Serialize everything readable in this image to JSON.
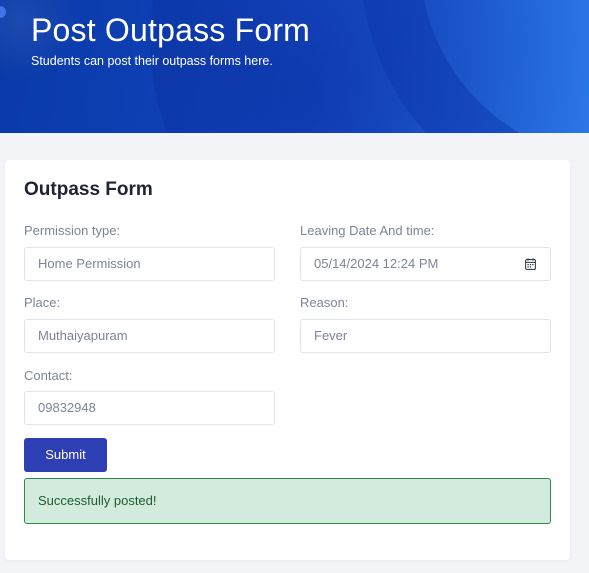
{
  "header": {
    "title": "Post Outpass Form",
    "subtitle": "Students can post their outpass forms here."
  },
  "form": {
    "title": "Outpass Form",
    "permission_type": {
      "label": "Permission type:",
      "value": "Home Permission"
    },
    "leaving_datetime": {
      "label": "Leaving Date And time:",
      "value": "05/14/2024 12:24  PM"
    },
    "place": {
      "label": "Place:",
      "value": "Muthaiyapuram"
    },
    "reason": {
      "label": "Reason:",
      "value": "Fever"
    },
    "contact": {
      "label": "Contact:",
      "value": "09832948"
    },
    "submit_label": "Submit",
    "success_message": "Successfully posted!"
  },
  "icons": {
    "calendar": "calendar-icon"
  },
  "colors": {
    "header_gradient_start": "#0a3aa8",
    "header_gradient_end": "#2f7fef",
    "submit_button": "#2e3fb3",
    "success_background": "#d3ebdc",
    "success_border": "#2f8a4e",
    "success_text": "#1d5c33"
  }
}
